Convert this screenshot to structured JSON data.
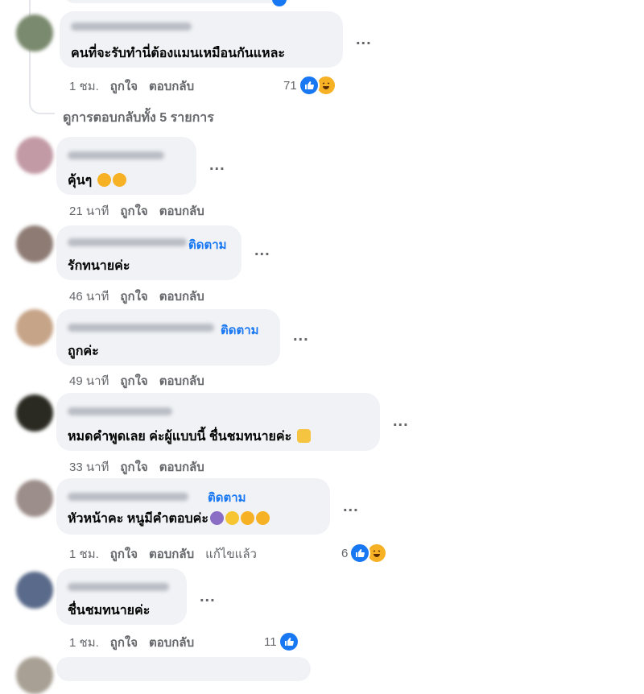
{
  "top_reply": {
    "text": "คนที่จะรับทำนี่ต้องแมนเหมือนกันแหละ",
    "time": "1 ชม.",
    "like": "ถูกใจ",
    "reply": "ตอบกลับ",
    "reaction_count": "71",
    "reactions": [
      "like-icon",
      "haha-icon"
    ]
  },
  "view_all_replies": "ดูการตอบกลับทั้ง 5 รายการ",
  "comments": [
    {
      "text": "คุ้นๆ",
      "emojis": [
        "rofl",
        "rofl"
      ],
      "time": "21 นาที",
      "like": "ถูกใจ",
      "reply": "ตอบกลับ"
    },
    {
      "follow": "ติดตาม",
      "text": "รักทนายค่ะ",
      "time": "46 นาที",
      "like": "ถูกใจ",
      "reply": "ตอบกลับ"
    },
    {
      "follow": "ติดตาม",
      "text": "ถูกค่ะ",
      "time": "49 นาที",
      "like": "ถูกใจ",
      "reply": "ตอบกลับ"
    },
    {
      "text": "หมดคำพูดเลย ค่ะผู้แบบนี้ ชื่นชมทนายค่ะ",
      "emojis": [
        "pray"
      ],
      "time": "33 นาที",
      "like": "ถูกใจ",
      "reply": "ตอบกลับ"
    },
    {
      "follow": "ติดตาม",
      "text": "หัวหน้าคะ หนูมีคำตอบค่ะ",
      "emojis": [
        "woman",
        "grin",
        "rofl",
        "rofl"
      ],
      "time": "1 ชม.",
      "like": "ถูกใจ",
      "reply": "ตอบกลับ",
      "edited": "แก้ไขแล้ว",
      "reaction_count": "6",
      "reactions": [
        "like-icon",
        "haha-icon"
      ]
    },
    {
      "text": "ชื่นชมทนายค่ะ",
      "time": "1 ชม.",
      "like": "ถูกใจ",
      "reply": "ตอบกลับ",
      "reaction_count": "11",
      "reactions": [
        "like-icon"
      ]
    }
  ],
  "more_label": "...",
  "colors": {
    "accent": "#1877f2",
    "bubble": "#f0f2f5",
    "meta": "#65676b",
    "haha": "#f7b125"
  }
}
